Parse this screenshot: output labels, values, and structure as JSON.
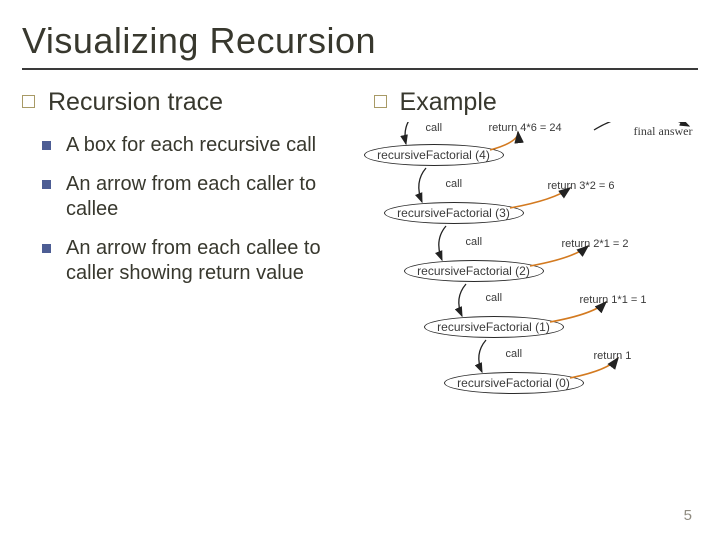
{
  "title": "Visualizing Recursion",
  "left": {
    "heading": "Recursion trace",
    "items": [
      "A box for each recursive call",
      "An arrow from each caller to callee",
      "An arrow from each callee to caller showing return value"
    ]
  },
  "right": {
    "heading": "Example",
    "nodes": {
      "n4": "recursiveFactorial  (4)",
      "n3": "recursiveFactorial  (3)",
      "n2": "recursiveFactorial  (2)",
      "n1": "recursiveFactorial  (1)",
      "n0": "recursiveFactorial  (0)"
    },
    "calls": {
      "c0": "call",
      "c1": "call",
      "c2": "call",
      "c3": "call",
      "c4": "call"
    },
    "returns": {
      "r24": "return  4*6 = 24",
      "r6": "return  3*2 = 6",
      "r2": "return  2*1 = 2",
      "r1": "return  1*1 = 1",
      "r0": "return  1"
    },
    "final": "final answer"
  },
  "page": "5"
}
